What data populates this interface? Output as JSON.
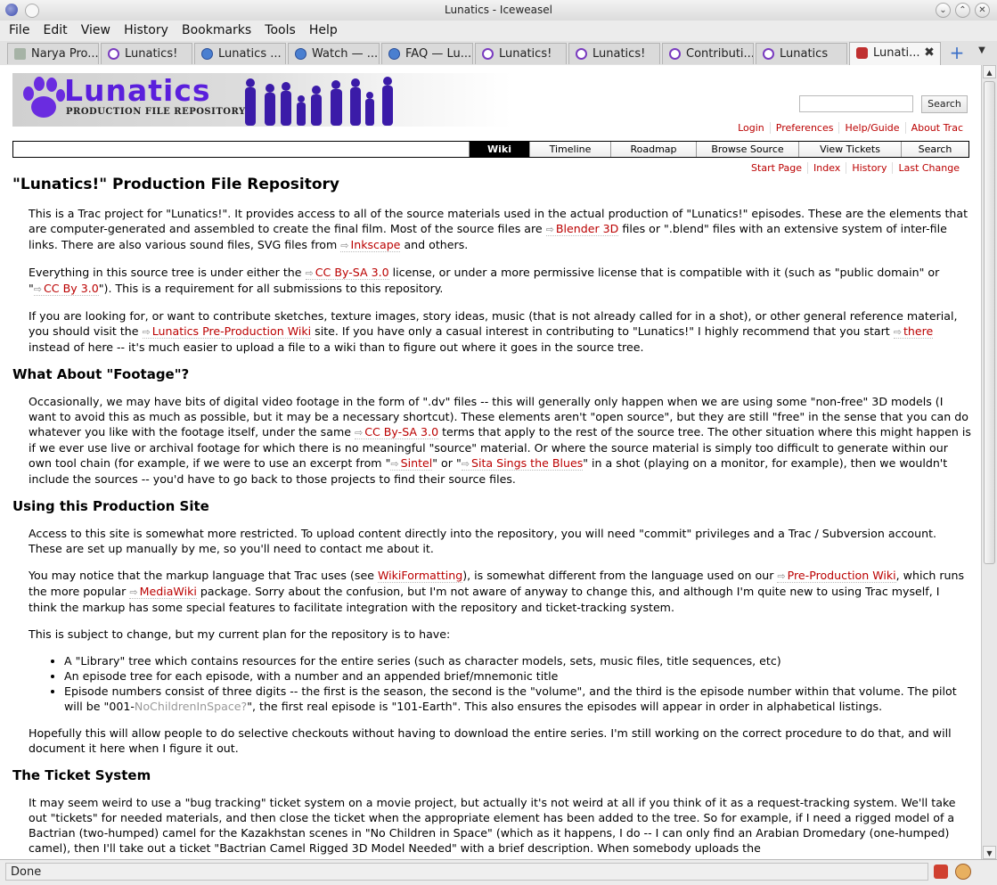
{
  "window": {
    "title": "Lunatics - Iceweasel"
  },
  "menubar": [
    "File",
    "Edit",
    "View",
    "History",
    "Bookmarks",
    "Tools",
    "Help"
  ],
  "tabs": [
    {
      "label": "Narya Pro...",
      "icon": "gray-page-icon"
    },
    {
      "label": "Lunatics!",
      "icon": "purple-moon-icon"
    },
    {
      "label": "Lunatics ...",
      "icon": "blue-gear-icon"
    },
    {
      "label": "Watch — ...",
      "icon": "blue-gear-icon"
    },
    {
      "label": "FAQ — Lu...",
      "icon": "blue-gear-icon"
    },
    {
      "label": "Lunatics!",
      "icon": "purple-moon-icon"
    },
    {
      "label": "Lunatics!",
      "icon": "purple-moon-icon"
    },
    {
      "label": "Contributi...",
      "icon": "purple-moon-icon"
    },
    {
      "label": "Lunatics",
      "icon": "purple-moon-icon"
    },
    {
      "label": "Lunati...",
      "icon": "trac-paw-icon",
      "active": true
    }
  ],
  "header": {
    "logo_text": "Lunatics",
    "logo_sub": "PRODUCTION FILE REPOSITORY",
    "search_button": "Search"
  },
  "metanav": [
    "Login",
    "Preferences",
    "Help/Guide",
    "About Trac"
  ],
  "mainnav": [
    "Wiki",
    "Timeline",
    "Roadmap",
    "Browse Source",
    "View Tickets",
    "Search"
  ],
  "ctxtnav": [
    "Start Page",
    "Index",
    "History",
    "Last Change"
  ],
  "page": {
    "title": "\"Lunatics!\" Production File Repository",
    "p1a": "This is a Trac project for \"Lunatics!\". It provides access to all of the source materials used in the actual production of \"Lunatics!\" episodes. These are the elements that are computer-generated and assembled to create the final film. Most of the source files are ",
    "link_blender": "Blender 3D",
    "p1b": " files or \".blend\" files with an extensive system of inter-file links. There are also various sound files, SVG files from ",
    "link_inkscape": "Inkscape",
    "p1c": " and others.",
    "p2a": "Everything in this source tree is under either the ",
    "link_ccbysa": "CC By-SA 3.0",
    "p2b": " license, or under a more permissive license that is compatible with it (such as \"public domain\" or \"",
    "link_ccby": "CC By 3.0",
    "p2c": "\"). This is a requirement for all submissions to this repository.",
    "p3a": "If you are looking for, or want to contribute sketches, texture images, story ideas, music (that is not already called for in a shot), or other general reference material, you should visit the ",
    "link_prewiki": "Lunatics Pre-Production Wiki",
    "p3b": " site. If you have only a casual interest in contributing to \"Lunatics!\" I highly recommend that you start ",
    "link_there": "there",
    "p3c": " instead of here -- it's much easier to upload a file to a wiki than to figure out where it goes in the source tree.",
    "h_footage": "What About \"Footage\"?",
    "p4a": "Occasionally, we may have bits of digital video footage in the form of \".dv\" files -- this will generally only happen when we are using some \"non-free\" 3D models (I want to avoid this as much as possible, but it may be a necessary shortcut). These elements aren't \"open source\", but they are still \"free\" in the sense that you can do whatever you like with the footage itself, under the same ",
    "link_ccbysa2": "CC By-SA 3.0",
    "p4b": " terms that apply to the rest of the source tree. The other situation where this might happen is if we ever use live or archival footage for which there is no meaningful \"source\" material. Or where the source material is simply too difficult to generate within our own tool chain (for example, if we were to use an excerpt from \"",
    "link_sintel": "Sintel",
    "p4c": "\" or \"",
    "link_sita": "Sita Sings the Blues",
    "p4d": "\" in a shot (playing on a monitor, for example), then we wouldn't include the sources -- you'd have to go back to those projects to find their source files.",
    "h_using": "Using this Production Site",
    "p5": "Access to this site is somewhat more restricted. To upload content directly into the repository, you will need \"commit\" privileges and a Trac / Subversion account. These are set up manually by me, so you'll need to contact me about it.",
    "p6a": "You may notice that the markup language that Trac uses (see ",
    "link_wikiformatting": "WikiFormatting",
    "p6b": "), is somewhat different from the language used on our ",
    "link_prewiki2": "Pre-Production Wiki",
    "p6c": ", which runs the more popular ",
    "link_mediawiki": "MediaWiki",
    "p6d": " package. Sorry about the confusion, but I'm not aware of anyway to change this, and although I'm quite new to using Trac myself, I think the markup has some special features to facilitate integration with the repository and ticket-tracking system.",
    "p7": "This is subject to change, but my current plan for the repository is to have:",
    "li1": "A \"Library\" tree which contains resources for the entire series (such as character models, sets, music files, title sequences, etc)",
    "li2": "An episode tree for each episode, with a number and an appended brief/mnemonic title",
    "li3a": "Episode numbers consist of three digits -- the first is the season, the second is the \"volume\", and the third is the episode number within that volume. The pilot will be \"001-",
    "link_nochildren": "NoChildrenInSpace?",
    "li3b": "\", the first real episode is \"101-Earth\". This also ensures the episodes will appear in order in alphabetical listings.",
    "p8": "Hopefully this will allow people to do selective checkouts without having to download the entire series. I'm still working on the correct procedure to do that, and will document it here when I figure it out.",
    "h_ticket": "The Ticket System",
    "p9": "It may seem weird to use a \"bug tracking\" ticket system on a movie project, but actually it's not weird at all if you think of it as a request-tracking system. We'll take out \"tickets\" for needed materials, and then close the ticket when the appropriate element has been added to the tree. So for example, if I need a rigged model of a Bactrian (two-humped) camel for the Kazakhstan scenes in \"No Children in Space\" (which as it happens, I do -- I can only find an Arabian Dromedary (one-humped) camel), then I'll take out a ticket \"Bactrian Camel Rigged 3D Model Needed\" with a brief description. When somebody uploads the"
  },
  "status": {
    "text": "Done"
  }
}
